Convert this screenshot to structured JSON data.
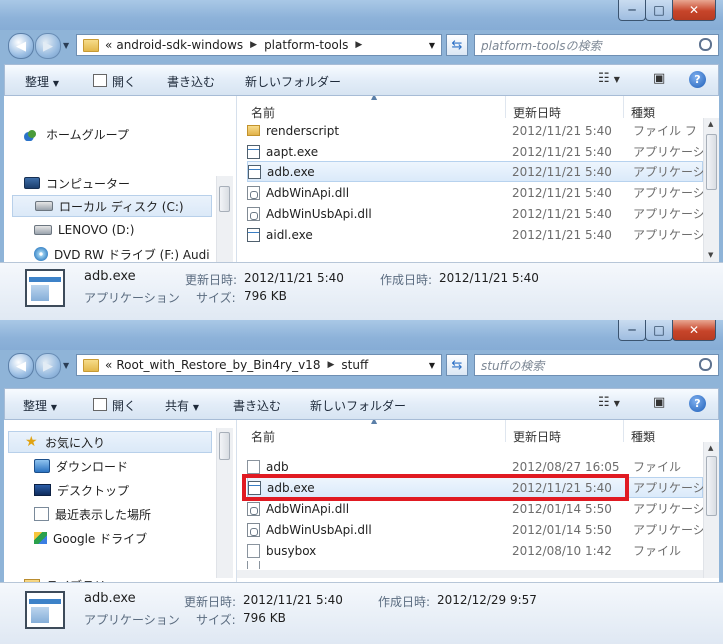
{
  "win1": {
    "address": {
      "overflow": "«",
      "crumbs": [
        "android-sdk-windows",
        "platform-tools"
      ]
    },
    "search_placeholder": "platform-toolsの検索",
    "toolbar": {
      "organize": "整理",
      "open": "開く",
      "burn": "書き込む",
      "new_folder": "新しいフォルダー"
    },
    "nav": [
      "ホームグループ",
      "コンピューター",
      "ローカル ディスク (C:)",
      "LENOVO (D:)",
      "DVD RW ドライブ (F:) Audi"
    ],
    "columns": {
      "name": "名前",
      "date": "更新日時",
      "type": "種類"
    },
    "files": [
      {
        "name": "renderscript",
        "date": "2012/11/21 5:40",
        "type": "ファイル フ",
        "icon": "folder-icon"
      },
      {
        "name": "aapt.exe",
        "date": "2012/11/21 5:40",
        "type": "アプリケーシ",
        "icon": "exe-icon"
      },
      {
        "name": "adb.exe",
        "date": "2012/11/21 5:40",
        "type": "アプリケーシ",
        "icon": "exe-icon"
      },
      {
        "name": "AdbWinApi.dll",
        "date": "2012/11/21 5:40",
        "type": "アプリケーシ",
        "icon": "dll-icon"
      },
      {
        "name": "AdbWinUsbApi.dll",
        "date": "2012/11/21 5:40",
        "type": "アプリケーシ",
        "icon": "dll-icon"
      },
      {
        "name": "aidl.exe",
        "date": "2012/11/21 5:40",
        "type": "アプリケーシ",
        "icon": "exe-icon"
      }
    ],
    "details": {
      "filename": "adb.exe",
      "filetype": "アプリケーション",
      "modified_label": "更新日時:",
      "modified": "2012/11/21 5:40",
      "created_label": "作成日時:",
      "created": "2012/11/21 5:40",
      "size_label": "サイズ:",
      "size": "796 KB"
    }
  },
  "win2": {
    "address": {
      "overflow": "«",
      "crumbs": [
        "Root_with_Restore_by_Bin4ry_v18",
        "stuff"
      ]
    },
    "search_placeholder": "stuffの検索",
    "toolbar": {
      "organize": "整理",
      "open": "開く",
      "share": "共有",
      "burn": "書き込む",
      "new_folder": "新しいフォルダー"
    },
    "nav": [
      "お気に入り",
      "ダウンロード",
      "デスクトップ",
      "最近表示した場所",
      "Google ドライブ",
      "ライブラリ"
    ],
    "columns": {
      "name": "名前",
      "date": "更新日時",
      "type": "種類"
    },
    "files": [
      {
        "name": "adb",
        "date": "2012/08/27 16:05",
        "type": "ファイル",
        "icon": "blank-file-icon"
      },
      {
        "name": "adb.exe",
        "date": "2012/11/21 5:40",
        "type": "アプリケーシ",
        "icon": "exe-icon"
      },
      {
        "name": "AdbWinApi.dll",
        "date": "2012/01/14 5:50",
        "type": "アプリケーシ",
        "icon": "dll-icon"
      },
      {
        "name": "AdbWinUsbApi.dll",
        "date": "2012/01/14 5:50",
        "type": "アプリケーシ",
        "icon": "dll-icon"
      },
      {
        "name": "busybox",
        "date": "2012/08/10 1:42",
        "type": "ファイル",
        "icon": "blank-file-icon"
      }
    ],
    "details": {
      "filename": "adb.exe",
      "filetype": "アプリケーション",
      "modified_label": "更新日時:",
      "modified": "2012/11/21 5:40",
      "created_label": "作成日時:",
      "created": "2012/12/29 9:57",
      "size_label": "サイズ:",
      "size": "796 KB"
    }
  },
  "window_controls": {
    "minimize": "─",
    "maximize": "□",
    "close": "✕"
  },
  "colors": {
    "highlight_box": "#e01a22",
    "titlebar": "#8db2d9"
  }
}
